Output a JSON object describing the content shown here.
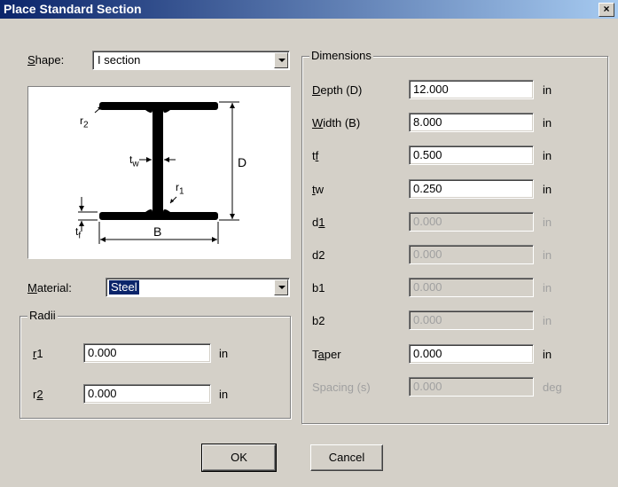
{
  "window": {
    "title": "Place Standard Section",
    "close_label": "×"
  },
  "shape": {
    "label": "Shape:",
    "value": "I section"
  },
  "diagram": {
    "r2": "r",
    "r2_sub": "2",
    "tw": "t",
    "tw_sub": "w",
    "r1": "r",
    "r1_sub": "1",
    "D": "D",
    "tf": "t",
    "tf_sub": "f",
    "B": "B"
  },
  "material": {
    "label": "Material:",
    "value": "Steel"
  },
  "radii": {
    "title": "Radii",
    "r1_label": "r1",
    "r1_value": "0.000",
    "r1_unit": "in",
    "r2_label": "r2",
    "r2_value": "0.000",
    "r2_unit": "in"
  },
  "dimensions": {
    "title": "Dimensions",
    "rows": [
      {
        "label": "Depth (D)",
        "value": "12.000",
        "unit": "in",
        "enabled": true
      },
      {
        "label": "Width (B)",
        "value": "8.000",
        "unit": "in",
        "enabled": true
      },
      {
        "label": "tf",
        "value": "0.500",
        "unit": "in",
        "enabled": true
      },
      {
        "label": "tw",
        "value": "0.250",
        "unit": "in",
        "enabled": true
      },
      {
        "label": "d1",
        "value": "0.000",
        "unit": "in",
        "enabled": false
      },
      {
        "label": "d2",
        "value": "0.000",
        "unit": "in",
        "enabled": false
      },
      {
        "label": "b1",
        "value": "0.000",
        "unit": "in",
        "enabled": false
      },
      {
        "label": "b2",
        "value": "0.000",
        "unit": "in",
        "enabled": false
      },
      {
        "label": "Taper",
        "value": "0.000",
        "unit": "in",
        "enabled": true
      },
      {
        "label": "Spacing (s)",
        "value": "0.000",
        "unit": "deg",
        "enabled": false
      }
    ]
  },
  "buttons": {
    "ok": "OK",
    "cancel": "Cancel"
  }
}
